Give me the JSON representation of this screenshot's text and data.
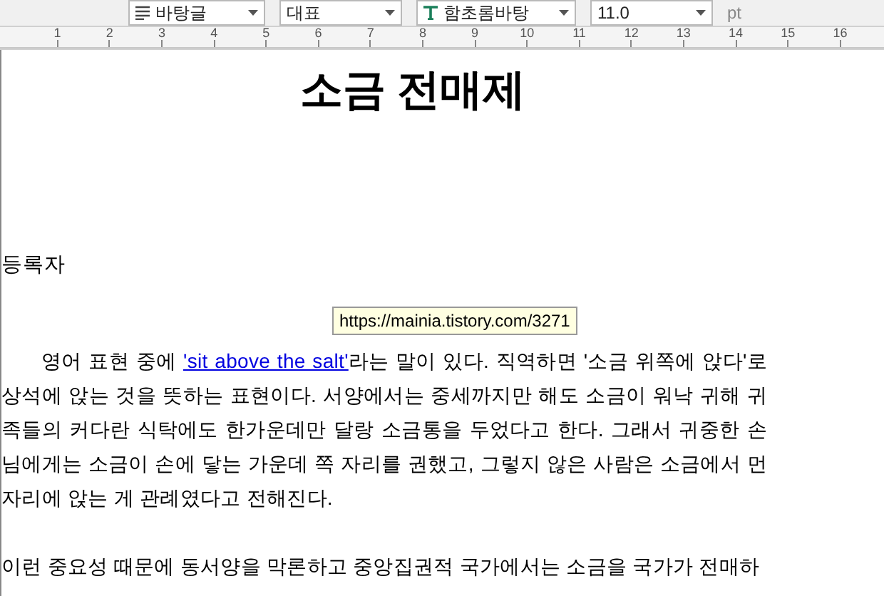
{
  "toolbar": {
    "dropdowns": [
      {
        "kind": "style",
        "value": "바탕글"
      },
      {
        "kind": "plain",
        "value": "대표"
      },
      {
        "kind": "font",
        "value": "함초롬바탕"
      },
      {
        "kind": "plain",
        "value": "11.0"
      }
    ],
    "unit": "pt"
  },
  "ruler": {
    "marks": [
      "1",
      "2",
      "3",
      "4",
      "5",
      "6",
      "7",
      "8",
      "9",
      "10",
      "11",
      "12",
      "13",
      "14",
      "15",
      "16"
    ]
  },
  "document": {
    "title": "소금 전매제",
    "author_label": "등록자",
    "paragraphs": [
      {
        "indent": true,
        "before": "영어 표현 중에 ",
        "link": "'sit above the salt'",
        "after": "라는 말이 있다. 직역하면 '소금 위쪽에 앉다'로 상석에 앉는 것을 뜻하는 표현이다. 서양에서는 중세까지만 해도 소금이 워낙 귀해 귀족들의 커다란 식탁에도 한가운데만 달랑 소금통을 두었다고 한다. 그래서 귀중한 손님에게는 소금이 손에 닿는 가운데 쪽 자리를 권했고, 그렇지 않은 사람은 소금에서 먼 자리에 앉는 게 관례였다고 전해진다."
      },
      {
        "indent": false,
        "before": "이런 중요성 때문에 동서양을 막론하고 중앙집권적 국가에서는 소금을 국가가 전매하"
      }
    ]
  },
  "tooltip": {
    "text": "https://mainia.tistory.com/3271"
  }
}
